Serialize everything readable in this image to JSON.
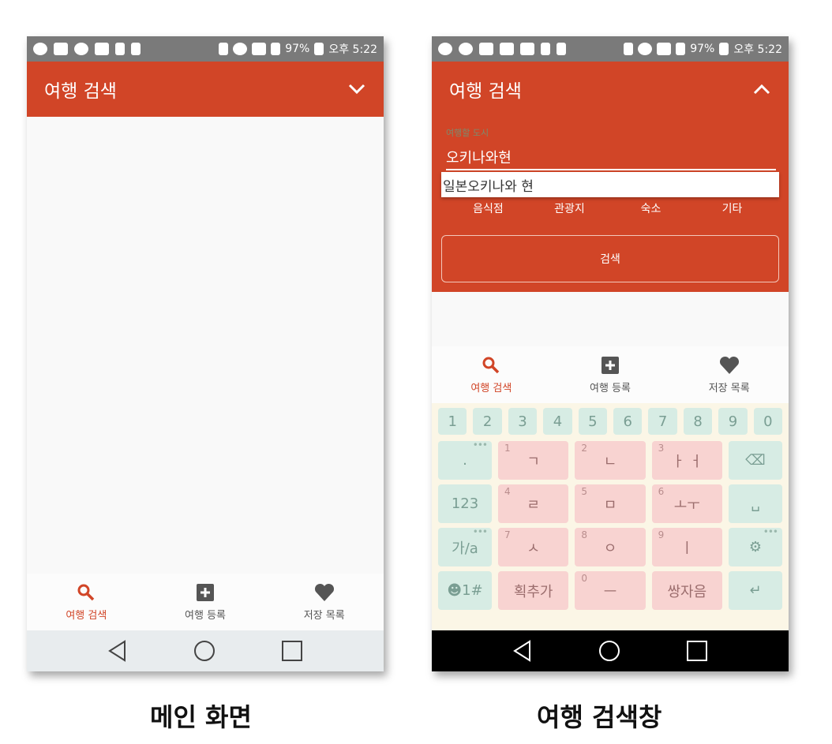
{
  "main_screen": {
    "status": {
      "battery": "97%",
      "time": "오후 5:22"
    },
    "appbar_title": "여행 검색",
    "nav": [
      {
        "label": "여행 검색",
        "icon": "search-icon",
        "active": true
      },
      {
        "label": "여행 등록",
        "icon": "plus-box-icon",
        "active": false
      },
      {
        "label": "저장 목록",
        "icon": "heart-icon",
        "active": false
      }
    ],
    "caption": "메인 화면"
  },
  "search_screen": {
    "status": {
      "battery": "97%",
      "time": "오후 5:22"
    },
    "appbar_title": "여행 검색",
    "field_label": "여행할 도시",
    "field_value": "오키나와현",
    "suggestion": "일본오키나와 현",
    "categories": [
      "음식점",
      "관광지",
      "숙소",
      "기타"
    ],
    "search_button": "검색",
    "nav": [
      {
        "label": "여행 검색",
        "icon": "search-icon",
        "active": true
      },
      {
        "label": "여행 등록",
        "icon": "plus-box-icon",
        "active": false
      },
      {
        "label": "저장 목록",
        "icon": "heart-icon",
        "active": false
      }
    ],
    "keyboard": {
      "numbers": [
        "1",
        "2",
        "3",
        "4",
        "5",
        "6",
        "7",
        "8",
        "9",
        "0"
      ],
      "rows": [
        {
          "left": ".",
          "keys": [
            {
              "num": "1",
              "char": "ㄱ"
            },
            {
              "num": "2",
              "char": "ㄴ"
            },
            {
              "num": "3",
              "char": "ㅏ ㅓ"
            }
          ],
          "right": "⌫"
        },
        {
          "left": "123",
          "keys": [
            {
              "num": "4",
              "char": "ㄹ"
            },
            {
              "num": "5",
              "char": "ㅁ"
            },
            {
              "num": "6",
              "char": "ㅗㅜ"
            }
          ],
          "right": "␣"
        },
        {
          "left": "가/a",
          "keys": [
            {
              "num": "7",
              "char": "ㅅ"
            },
            {
              "num": "8",
              "char": "ㅇ"
            },
            {
              "num": "9",
              "char": "ㅣ"
            }
          ],
          "right": "⚙"
        },
        {
          "left": "☻1#",
          "keys": [
            {
              "num": "",
              "char": "획추가"
            },
            {
              "num": "0",
              "char": "ㅡ"
            },
            {
              "num": "",
              "char": "쌍자음"
            }
          ],
          "right": "↵"
        }
      ]
    },
    "caption": "여행 검색창"
  },
  "colors": {
    "accent": "#d14527",
    "keyboard_bg": "#fbf6e6",
    "key_main": "#f8d3d1",
    "key_side": "#d7ece4"
  }
}
